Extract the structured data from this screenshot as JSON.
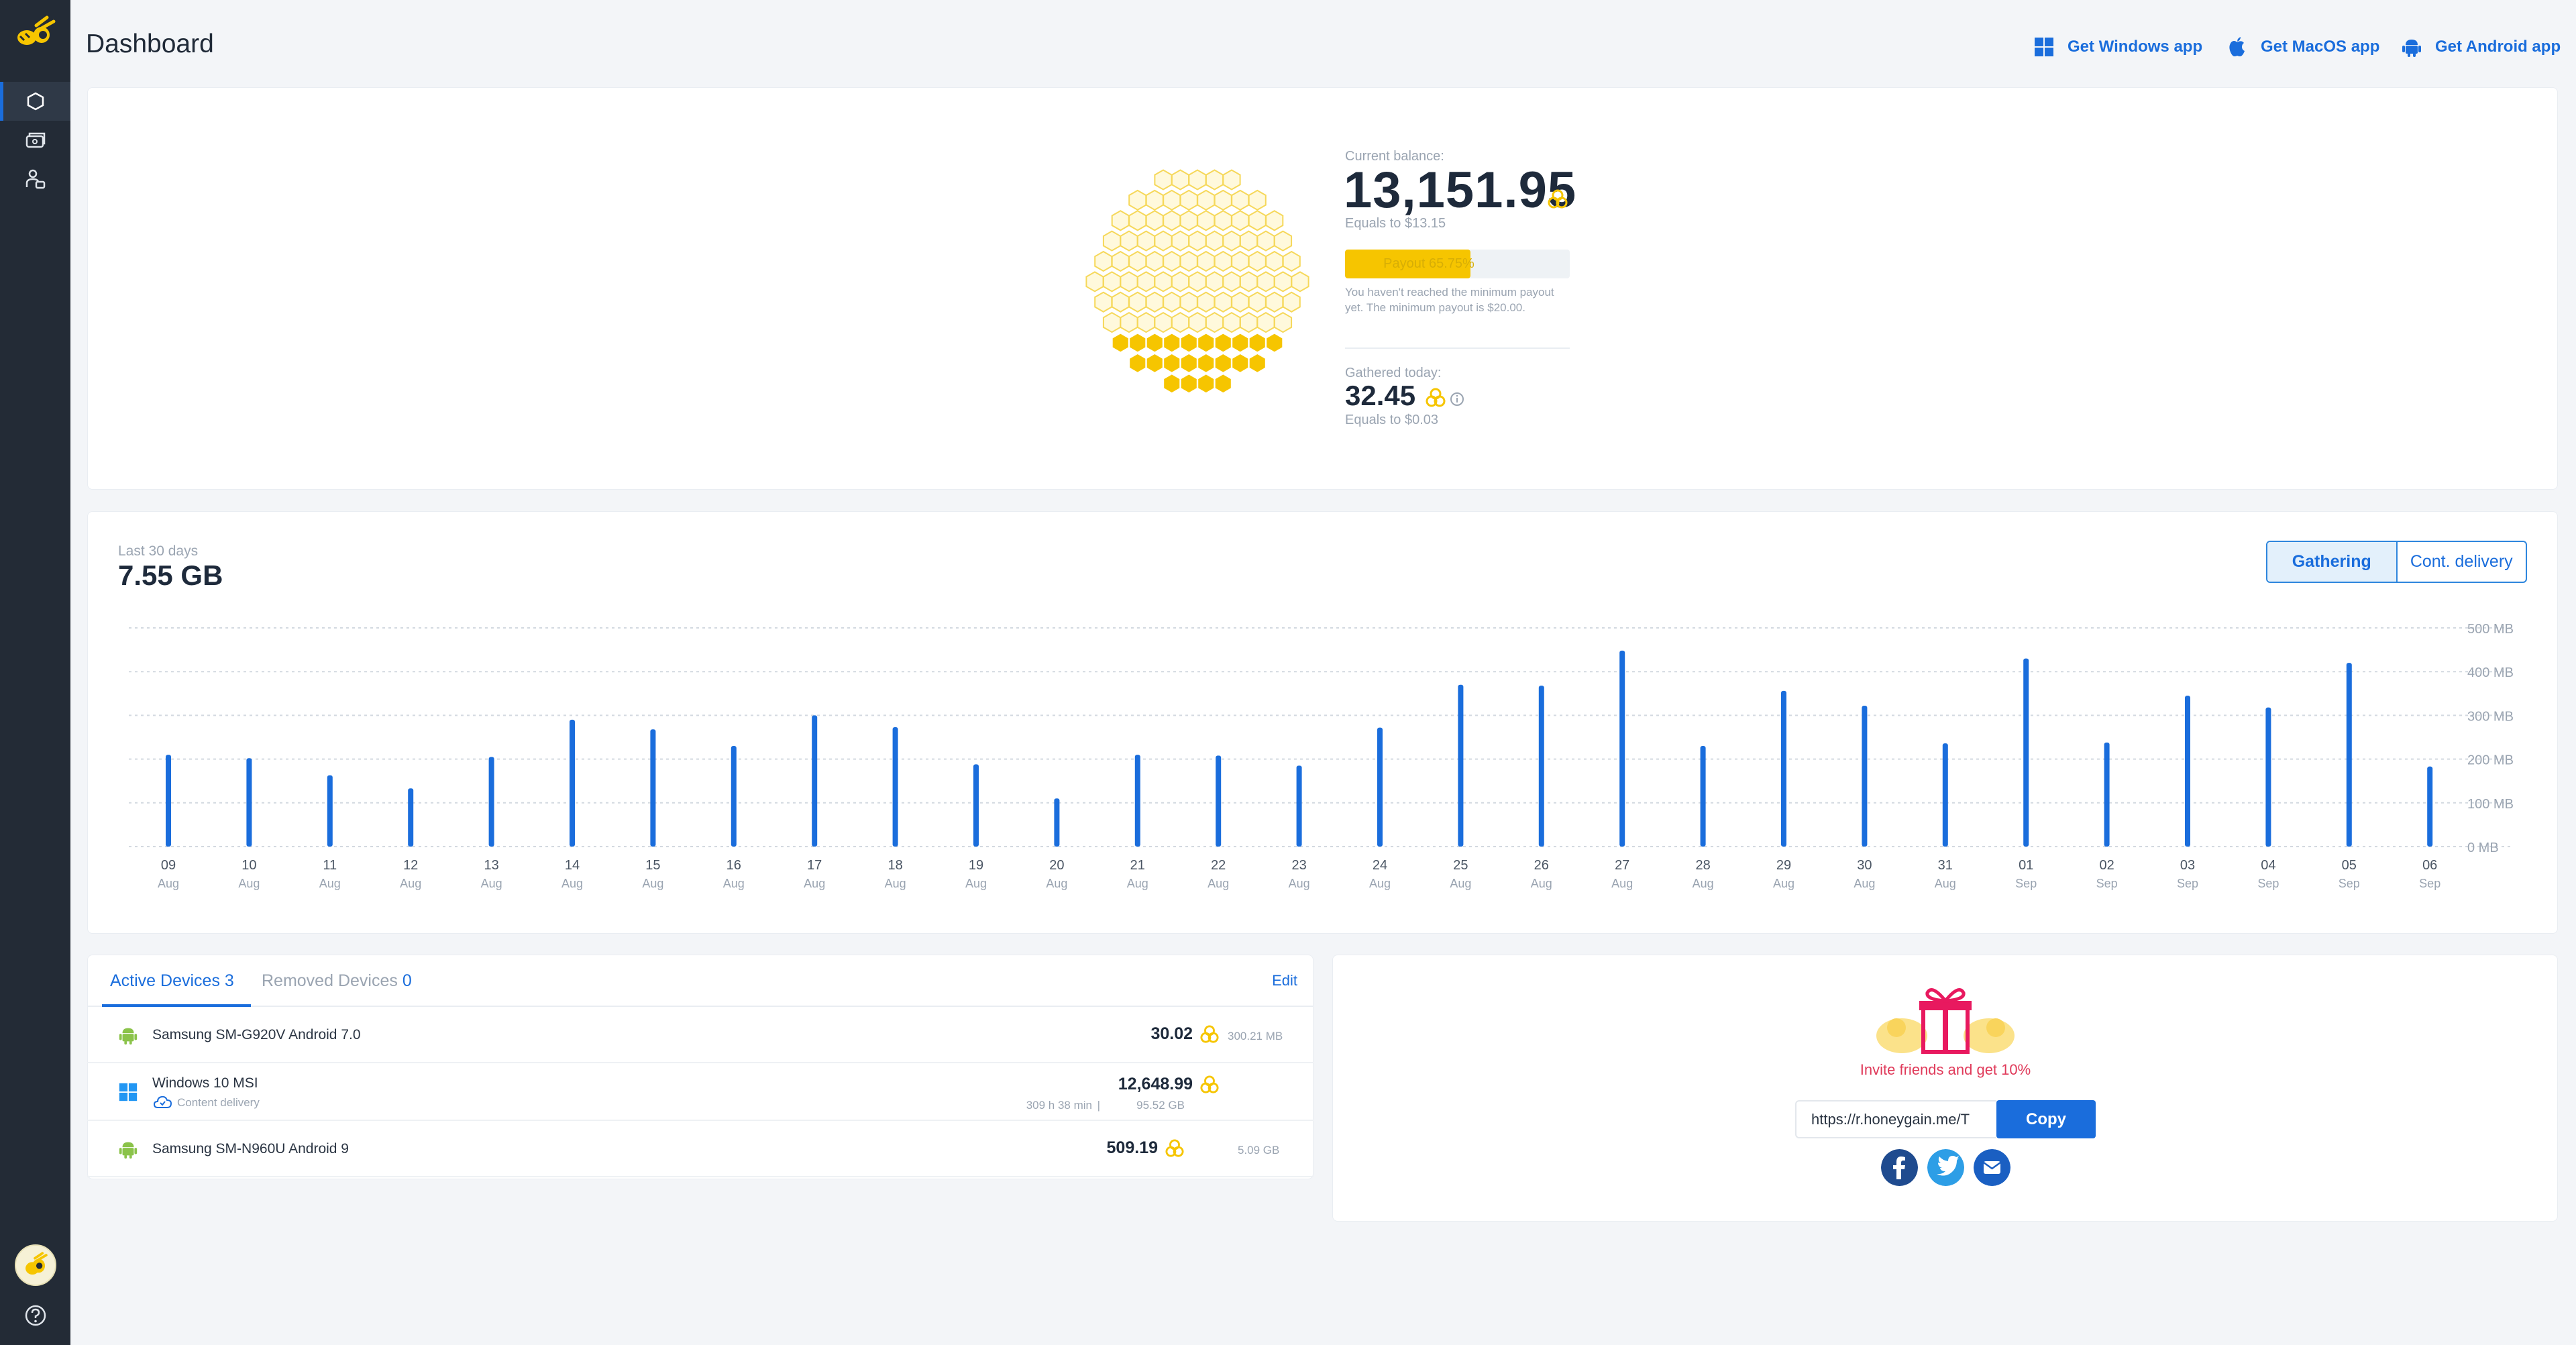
{
  "page": {
    "title": "Dashboard"
  },
  "sidebar": {
    "items": [
      {
        "name": "dashboard",
        "icon": "hexagon-icon",
        "active": true
      },
      {
        "name": "wallet",
        "icon": "wallet-icon",
        "active": false
      },
      {
        "name": "referrals",
        "icon": "people-icon",
        "active": false
      }
    ],
    "help_icon": "help-icon"
  },
  "header": {
    "windows_app": "Get Windows app",
    "macos_app": "Get MacOS app",
    "android_app": "Get Android app"
  },
  "balance": {
    "label": "Current balance:",
    "amount": "13,151.95",
    "equals": "Equals to $13.15",
    "payout_label": "Payout 65.75%",
    "payout_progress_percent": 65.75,
    "note": "You haven't reached the minimum payout yet. The minimum payout is $20.00.",
    "today_label": "Gathered today:",
    "today_amount": "32.45",
    "today_equals": "Equals to $0.03"
  },
  "traffic": {
    "period_label": "Last 30 days",
    "total": "7.55 GB",
    "toggle": {
      "gathering": "Gathering",
      "cont_delivery": "Cont. delivery",
      "active": "gathering"
    }
  },
  "chart_data": {
    "type": "bar",
    "categories": [
      "09",
      "10",
      "11",
      "12",
      "13",
      "14",
      "15",
      "16",
      "17",
      "18",
      "19",
      "20",
      "21",
      "22",
      "23",
      "24",
      "25",
      "26",
      "27",
      "28",
      "29",
      "30",
      "31",
      "01",
      "02",
      "03",
      "04",
      "05",
      "06"
    ],
    "months": [
      "Aug",
      "Aug",
      "Aug",
      "Aug",
      "Aug",
      "Aug",
      "Aug",
      "Aug",
      "Aug",
      "Aug",
      "Aug",
      "Aug",
      "Aug",
      "Aug",
      "Aug",
      "Aug",
      "Aug",
      "Aug",
      "Aug",
      "Aug",
      "Aug",
      "Aug",
      "Aug",
      "Sep",
      "Sep",
      "Sep",
      "Sep",
      "Sep",
      "Sep"
    ],
    "values": [
      210,
      202,
      163,
      133,
      205,
      290,
      268,
      230,
      300,
      273,
      188,
      110,
      210,
      208,
      185,
      272,
      370,
      368,
      448,
      230,
      356,
      322,
      236,
      430,
      238,
      345,
      318,
      420,
      183
    ],
    "yticks": [
      "0 MB",
      "100 MB",
      "200 MB",
      "300 MB",
      "400 MB",
      "500 MB"
    ],
    "ylim": [
      0,
      500
    ],
    "grid": true,
    "color": "#1a6ddc"
  },
  "devices": {
    "active_label": "Active Devices",
    "active_count": "3",
    "removed_label": "Removed Devices",
    "removed_count": "0",
    "edit_label": "Edit",
    "rows": [
      {
        "name": "Samsung SM-G920V Android 7.0",
        "platform_icon": "android-icon",
        "amount": "30.02",
        "data": "300.21 MB"
      },
      {
        "name": "Windows 10 MSI",
        "platform_icon": "windows-icon",
        "sub": "Content delivery",
        "amount": "12,648.99",
        "time": "309 h 38 min",
        "data": "95.52 GB"
      },
      {
        "name": "Samsung SM-N960U Android 9",
        "platform_icon": "android-icon",
        "amount": "509.19",
        "data": "5.09 GB"
      }
    ]
  },
  "invite": {
    "text": "Invite friends and get 10%",
    "link": "https://r.honeygain.me/T",
    "copy_label": "Copy",
    "gift_icon": "gift-icon",
    "socials": [
      "facebook-icon",
      "twitter-icon",
      "email-icon"
    ]
  },
  "colors": {
    "accent": "#1a6ddc",
    "honey": "#f6c500",
    "sidebar": "#232b36",
    "invite": "#e03a5a"
  }
}
